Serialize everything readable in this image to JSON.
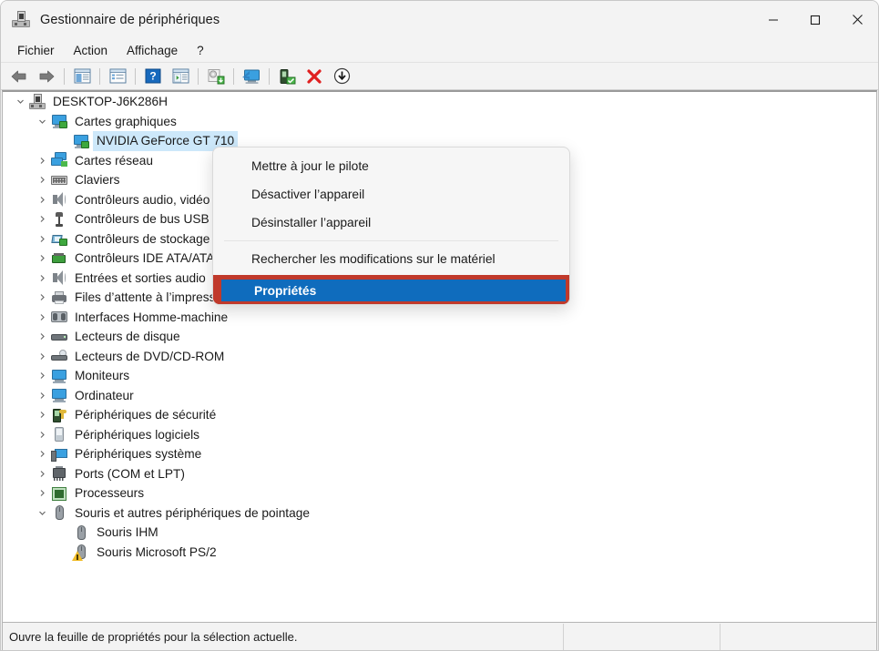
{
  "window": {
    "title": "Gestionnaire de périphériques",
    "icon": "device-manager-icon",
    "controls": {
      "minimize": "minimize-icon",
      "maximize": "maximize-icon",
      "close": "close-icon"
    }
  },
  "menubar": {
    "items": [
      {
        "label": "Fichier"
      },
      {
        "label": "Action"
      },
      {
        "label": "Affichage"
      },
      {
        "label": "?"
      }
    ]
  },
  "toolbar": {
    "buttons": [
      {
        "name": "back-icon"
      },
      {
        "name": "forward-icon"
      },
      {
        "name": "show-hide-console-tree-icon"
      },
      {
        "name": "properties-icon"
      },
      {
        "name": "help-icon"
      },
      {
        "name": "view-details-icon"
      },
      {
        "name": "update-driver-icon"
      },
      {
        "name": "scan-hardware-changes-icon"
      },
      {
        "name": "enable-device-icon"
      },
      {
        "name": "uninstall-device-icon"
      },
      {
        "name": "disable-device-icon"
      }
    ]
  },
  "tree": {
    "root": {
      "label": "DESKTOP-J6K286H",
      "icon": "computer-icon",
      "expanded": true
    },
    "nodes": [
      {
        "label": "Cartes graphiques",
        "icon": "display-adapter-icon",
        "indent": 1,
        "expanded": true,
        "hasChildren": true,
        "selected": false
      },
      {
        "label": "NVIDIA GeForce GT 710",
        "icon": "display-adapter-icon",
        "indent": 2,
        "expanded": false,
        "hasChildren": false,
        "selected": true
      },
      {
        "label": "Cartes réseau",
        "icon": "network-adapter-icon",
        "indent": 1,
        "expanded": false,
        "hasChildren": true,
        "selected": false
      },
      {
        "label": "Claviers",
        "icon": "keyboard-icon",
        "indent": 1,
        "expanded": false,
        "hasChildren": true,
        "selected": false
      },
      {
        "label": "Contrôleurs audio, vidéo et jeu",
        "icon": "sound-icon",
        "indent": 1,
        "expanded": false,
        "hasChildren": true,
        "selected": false
      },
      {
        "label": "Contrôleurs de bus USB",
        "icon": "usb-icon",
        "indent": 1,
        "expanded": false,
        "hasChildren": true,
        "selected": false
      },
      {
        "label": "Contrôleurs de stockage",
        "icon": "storage-controller-icon",
        "indent": 1,
        "expanded": false,
        "hasChildren": true,
        "selected": false
      },
      {
        "label": "Contrôleurs IDE ATA/ATAPI",
        "icon": "ide-controller-icon",
        "indent": 1,
        "expanded": false,
        "hasChildren": true,
        "selected": false
      },
      {
        "label": "Entrées et sorties audio",
        "icon": "sound-icon",
        "indent": 1,
        "expanded": false,
        "hasChildren": true,
        "selected": false
      },
      {
        "label": "Files d’attente à l’impression :",
        "icon": "printer-icon",
        "indent": 1,
        "expanded": false,
        "hasChildren": true,
        "selected": false
      },
      {
        "label": "Interfaces Homme-machine",
        "icon": "hid-icon",
        "indent": 1,
        "expanded": false,
        "hasChildren": true,
        "selected": false
      },
      {
        "label": "Lecteurs de disque",
        "icon": "disk-drive-icon",
        "indent": 1,
        "expanded": false,
        "hasChildren": true,
        "selected": false
      },
      {
        "label": "Lecteurs de DVD/CD-ROM",
        "icon": "dvd-drive-icon",
        "indent": 1,
        "expanded": false,
        "hasChildren": true,
        "selected": false
      },
      {
        "label": "Moniteurs",
        "icon": "monitor-icon",
        "indent": 1,
        "expanded": false,
        "hasChildren": true,
        "selected": false
      },
      {
        "label": "Ordinateur",
        "icon": "monitor-icon",
        "indent": 1,
        "expanded": false,
        "hasChildren": true,
        "selected": false
      },
      {
        "label": "Périphériques de sécurité",
        "icon": "security-device-icon",
        "indent": 1,
        "expanded": false,
        "hasChildren": true,
        "selected": false
      },
      {
        "label": "Périphériques logiciels",
        "icon": "software-device-icon",
        "indent": 1,
        "expanded": false,
        "hasChildren": true,
        "selected": false
      },
      {
        "label": "Périphériques système",
        "icon": "system-device-icon",
        "indent": 1,
        "expanded": false,
        "hasChildren": true,
        "selected": false
      },
      {
        "label": "Ports (COM et LPT)",
        "icon": "port-icon",
        "indent": 1,
        "expanded": false,
        "hasChildren": true,
        "selected": false
      },
      {
        "label": "Processeurs",
        "icon": "processor-icon",
        "indent": 1,
        "expanded": false,
        "hasChildren": true,
        "selected": false
      },
      {
        "label": "Souris et autres périphériques de pointage",
        "icon": "mouse-icon",
        "indent": 1,
        "expanded": true,
        "hasChildren": true,
        "selected": false
      },
      {
        "label": "Souris IHM",
        "icon": "mouse-icon",
        "indent": 2,
        "expanded": false,
        "hasChildren": false,
        "selected": false
      },
      {
        "label": "Souris Microsoft PS/2",
        "icon": "mouse-warning-icon",
        "indent": 2,
        "expanded": false,
        "hasChildren": false,
        "selected": false
      }
    ]
  },
  "context_menu": {
    "items": [
      {
        "label": "Mettre à jour le pilote",
        "highlighted": false
      },
      {
        "label": "Désactiver l’appareil",
        "highlighted": false
      },
      {
        "label": "Désinstaller l’appareil",
        "highlighted": false
      },
      {
        "separator": true
      },
      {
        "label": "Rechercher les modifications sur le matériel",
        "highlighted": false
      },
      {
        "separator": true
      },
      {
        "label": "Propriétés",
        "highlighted": true
      }
    ],
    "highlighted_label": "Propriétés"
  },
  "statusbar": {
    "text": "Ouvre la feuille de propriétés pour la sélection actuelle."
  },
  "colors": {
    "selection_blue": "#0f6cbd",
    "tree_selection": "#cde8fa",
    "annotation_red": "#c0392b",
    "chrome": "#f3f3f3"
  }
}
